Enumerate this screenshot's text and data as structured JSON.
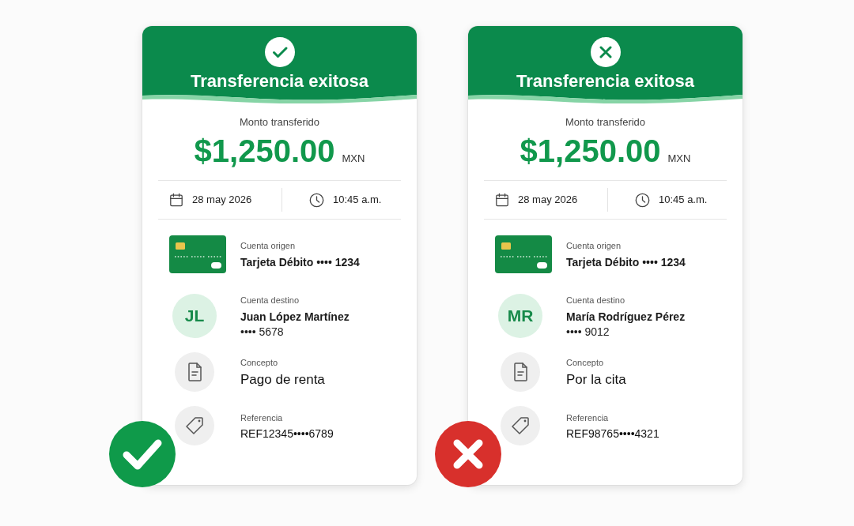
{
  "cards": [
    {
      "header": {
        "kind": "check",
        "title": "Transferencia exitosa"
      },
      "amount": {
        "label": "Monto transferido",
        "value": "$1,250.00",
        "currency": "MXN"
      },
      "date": "28 may 2026",
      "time": "10:45 a.m.",
      "details": [
        {
          "kind": "card",
          "label": "Cuenta origen",
          "value": "Tarjeta Débito •••• 1234"
        },
        {
          "kind": "avatar",
          "initials": "JL",
          "label": "Cuenta destino",
          "value": "Juan López Martínez",
          "account": "•••• 5678"
        },
        {
          "kind": "document",
          "label": "Concepto",
          "value": "Pago de renta"
        },
        {
          "kind": "tag",
          "label": "Referencia",
          "value": "REF12345••••6789"
        }
      ],
      "verdict_badge": {
        "kind": "check",
        "color": "#0f9a4a"
      }
    },
    {
      "header": {
        "kind": "cross",
        "title": "Transferencia exitosa"
      },
      "amount": {
        "label": "Monto transferido",
        "value": "$1,250.00",
        "currency": "MXN"
      },
      "date": "28 may 2026",
      "time": "10:45 a.m.",
      "details": [
        {
          "kind": "card",
          "label": "Cuenta origen",
          "value": "Tarjeta Débito •••• 1234"
        },
        {
          "kind": "avatar",
          "initials": "MR",
          "label": "Cuenta destino",
          "value": "María Rodríguez Pérez",
          "account": "•••• 9012"
        },
        {
          "kind": "document",
          "label": "Concepto",
          "value": "Por la cita"
        },
        {
          "kind": "tag",
          "label": "Referencia",
          "value": "REF98765••••4321"
        }
      ],
      "verdict_badge": {
        "kind": "cross",
        "color": "#d8302c"
      }
    }
  ]
}
